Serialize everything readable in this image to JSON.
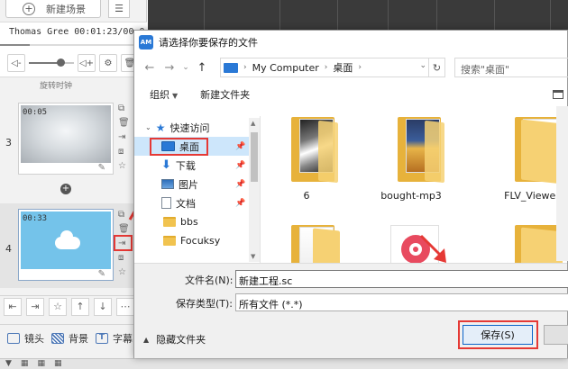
{
  "left_panel": {
    "new_scene_label": "新建场景",
    "player": {
      "track_text": "Thomas Gree 00:01:23/00:01:4",
      "progress_fraction": 0.2,
      "volume_fraction": 0.7
    },
    "duration_label": "旋转时钟",
    "scenes": [
      {
        "number": "3",
        "time": "00:05"
      },
      {
        "number": "4",
        "time": "00:33"
      }
    ],
    "bottom_tabs": [
      {
        "label": "镜头",
        "icon": "camera-icon"
      },
      {
        "label": "背景",
        "icon": "background-icon"
      },
      {
        "label": "字幕",
        "icon": "subtitle-icon"
      }
    ]
  },
  "dialog": {
    "app_badge": "AM",
    "title": "请选择你要保存的文件",
    "address": {
      "root": "My Computer",
      "current": "桌面"
    },
    "search_placeholder": "搜索\"桌面\"",
    "toolbar": {
      "organize": "组织",
      "new_folder": "新建文件夹"
    },
    "nav_items": [
      {
        "label": "快速访问",
        "icon": "star-icon",
        "pinned": false
      },
      {
        "label": "桌面",
        "icon": "desktop-icon",
        "pinned": true,
        "selected": true
      },
      {
        "label": "下载",
        "icon": "download-icon",
        "pinned": true
      },
      {
        "label": "图片",
        "icon": "pictures-icon",
        "pinned": true
      },
      {
        "label": "文档",
        "icon": "documents-icon",
        "pinned": true
      },
      {
        "label": "bbs",
        "icon": "folder-icon",
        "pinned": false
      },
      {
        "label": "Focuksy",
        "icon": "folder-icon",
        "pinned": false
      }
    ],
    "files": [
      {
        "name": "6"
      },
      {
        "name": "bought-mp3"
      },
      {
        "name": "FLV_Viewer"
      },
      {
        "name": ""
      },
      {
        "name": ""
      },
      {
        "name": ""
      }
    ],
    "filename_label": "文件名(N):",
    "filename_value": "新建工程.sc",
    "filetype_label": "保存类型(T):",
    "filetype_value": "所有文件 (*.*)",
    "hide_folders": "隐藏文件夹",
    "save_label": "保存(S)"
  },
  "colors": {
    "highlight": "#e53935",
    "accent": "#2a79d6",
    "folder": "#f6d173"
  }
}
